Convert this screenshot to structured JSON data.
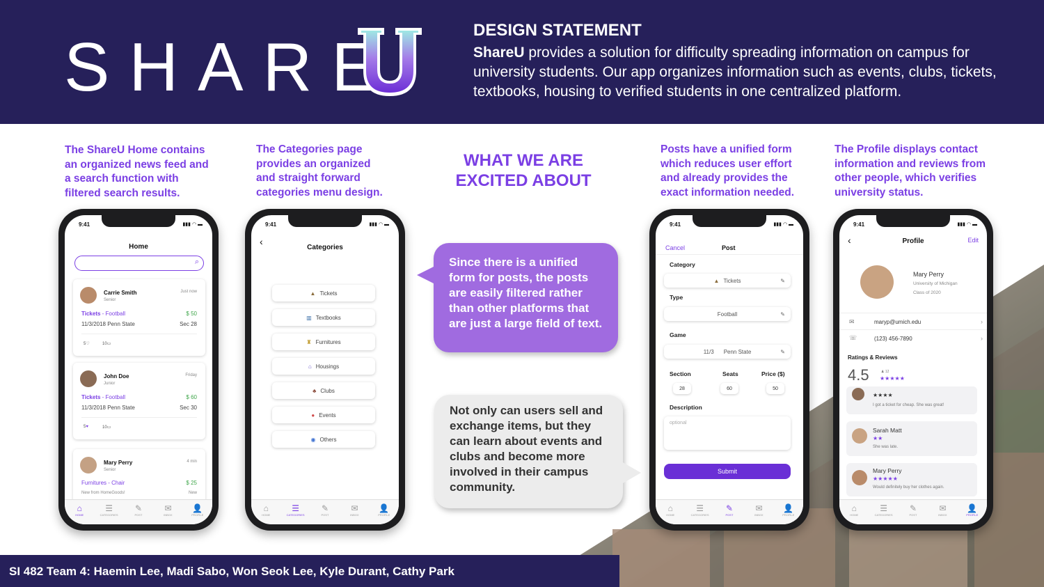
{
  "header": {
    "logo_text": "SHARE",
    "logo_u": "U",
    "design_title": "DESIGN STATEMENT",
    "design_brand": "ShareU",
    "design_body": " provides a solution for difficulty spreading information on campus for university students. Our app organizes information such as events, clubs, tickets, textbooks, housing to verified students in one centralized platform."
  },
  "captions": {
    "home": "The ShareU Home contains an organized news feed and a search function with filtered search results.",
    "categories": "The Categories page provides an organized and straight forward categories menu design.",
    "post": "Posts have a unified form which reduces user effort and already provides the exact information needed.",
    "profile": "The Profile displays contact information and reviews from other people, which verifies university status."
  },
  "excited": {
    "line1": "WHAT WE ARE",
    "line2": "EXCITED ABOUT",
    "bubble_purple": "Since there is a unified form for posts, the posts are easily filtered rather than other platforms that are just a large field of text.",
    "bubble_gray": "Not only can users sell and exchange items, but they can learn about events and clubs and become more involved in their campus community."
  },
  "footer": {
    "team": "SI 482 Team 4: Haemin Lee, Madi Sabo, Won Seok Lee, Kyle Durant, Cathy Park"
  },
  "status_time": "9:41",
  "tabs": [
    "HOME",
    "CATEGORIES",
    "POST",
    "INBOX",
    "PROFILE"
  ],
  "home": {
    "title": "Home",
    "posts": [
      {
        "name": "Carrie Smith",
        "year": "Senior",
        "time": "Just now",
        "category": "Tickets",
        "sub": "Football",
        "price": "$ 50",
        "date": "11/3/2018 Penn State",
        "detail": "Sec 28",
        "likes": "5",
        "comments": "10"
      },
      {
        "name": "John Doe",
        "year": "Junior",
        "time": "Friday",
        "category": "Tickets",
        "sub": "Football",
        "price": "$ 60",
        "date": "11/3/2018 Penn State",
        "detail": "Sec 30",
        "likes": "5",
        "comments": "10"
      },
      {
        "name": "Mary Perry",
        "year": "Senior",
        "time": "4 min",
        "category": "Furnitures",
        "sub": "Chair",
        "price": "$ 25",
        "date": "New from HomeGoods!",
        "detail": "New"
      }
    ]
  },
  "categories": {
    "title": "Categories",
    "items": [
      "Tickets",
      "Textbooks",
      "Furnitures",
      "Housings",
      "Clubs",
      "Events",
      "Others"
    ]
  },
  "post": {
    "cancel": "Cancel",
    "title": "Post",
    "category_label": "Category",
    "category_value": "Tickets",
    "type_label": "Type",
    "type_value": "Football",
    "game_label": "Game",
    "game_date": "11/3",
    "game_value": "Penn State",
    "section_label": "Section",
    "section_value": "28",
    "seats_label": "Seats",
    "seats_value": "60",
    "price_label": "Price ($)",
    "price_value": "50",
    "description_label": "Description",
    "description_placeholder": "optional",
    "submit": "Submit"
  },
  "profile": {
    "title": "Profile",
    "edit": "Edit",
    "name": "Mary Perry",
    "school": "University of Michigan",
    "class": "Class of 2020",
    "email": "maryp@umich.edu",
    "phone": "(123) 456-7890",
    "ratings_label": "Ratings & Reviews",
    "rating": "4.5",
    "rating_count": "12",
    "reviews": [
      {
        "name": "John Doe",
        "text": "I got a ticket for cheap. She was great!",
        "stars": 4
      },
      {
        "name": "Sarah Matt",
        "text": "She was late.",
        "stars": 2
      },
      {
        "name": "Mary Perry",
        "text": "Would definitely buy her clothes again.",
        "stars": 5
      }
    ]
  },
  "colors": {
    "navy": "#26205a",
    "accent": "#7b3fe4",
    "bubble": "#a06be0"
  }
}
